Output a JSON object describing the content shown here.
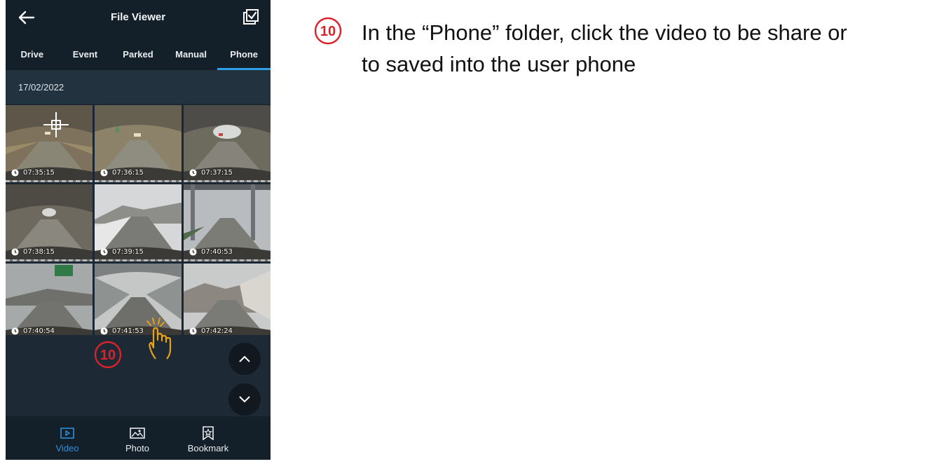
{
  "header": {
    "title": "File Viewer"
  },
  "tabs": [
    {
      "label": "Drive"
    },
    {
      "label": "Event"
    },
    {
      "label": "Parked"
    },
    {
      "label": "Manual"
    },
    {
      "label": "Phone",
      "active": true
    }
  ],
  "date_group": "17/02/2022",
  "thumbnails": [
    {
      "time": "07:35:15"
    },
    {
      "time": "07:36:15"
    },
    {
      "time": "07:37:15"
    },
    {
      "time": "07:38:15"
    },
    {
      "time": "07:39:15"
    },
    {
      "time": "07:40:53"
    },
    {
      "time": "07:40:54"
    },
    {
      "time": "07:41:53"
    },
    {
      "time": "07:42:24"
    }
  ],
  "bottom_nav": [
    {
      "label": "Video",
      "icon": "video-icon",
      "active": true
    },
    {
      "label": "Photo",
      "icon": "photo-icon"
    },
    {
      "label": "Bookmark",
      "icon": "bookmark-icon"
    }
  ],
  "step": {
    "number": "⑩",
    "text_line1": "In the “Phone” folder, click the video to be share or",
    "text_line2": "to saved into the user phone"
  },
  "colors": {
    "accent": "#2f9ee8",
    "step_red": "#d9232a",
    "hand_orange": "#e6a117",
    "panel_dark": "#142029"
  }
}
